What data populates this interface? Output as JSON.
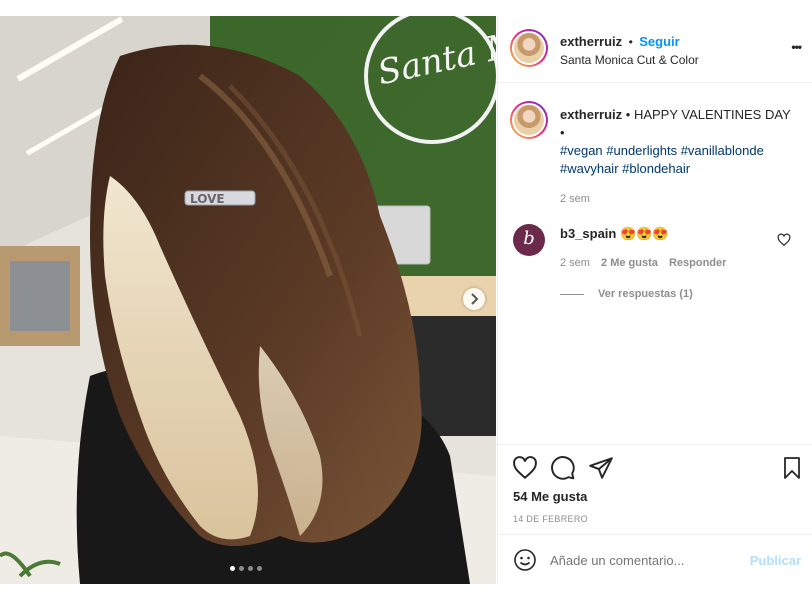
{
  "post": {
    "username": "extherruiz",
    "follow_label": "Seguir",
    "location": "Santa Monica Cut & Color",
    "more_label": "•••",
    "dot": "•"
  },
  "caption": {
    "username": "extherruiz",
    "text": "HAPPY VALENTINES DAY",
    "bullet": "•",
    "hashtags_line1": "#vegan #underlights #vanillablonde",
    "hashtags_line2": "#wavyhair #blondehair",
    "time": "2 sem"
  },
  "comment": {
    "username": "b3_spain",
    "emojis": "😍😍😍",
    "avatar_letter": "b",
    "time": "2 sem",
    "likes": "2 Me gusta",
    "reply": "Responder",
    "view_replies": "Ver respuestas (1)"
  },
  "photo_overlay": {
    "clip_text": "LOVE",
    "logo_text": "Santa Monica"
  },
  "actions": {
    "likes": "54 Me gusta",
    "date": "14 DE FEBRERO"
  },
  "add_comment": {
    "placeholder": "Añade un comentario...",
    "publish": "Publicar"
  },
  "carousel": {
    "count": 4,
    "active": 0
  },
  "colors": {
    "link": "#0095f6",
    "hashtag": "#00376b",
    "muted": "#8e8e8e",
    "wall": "#3c6a2c"
  }
}
